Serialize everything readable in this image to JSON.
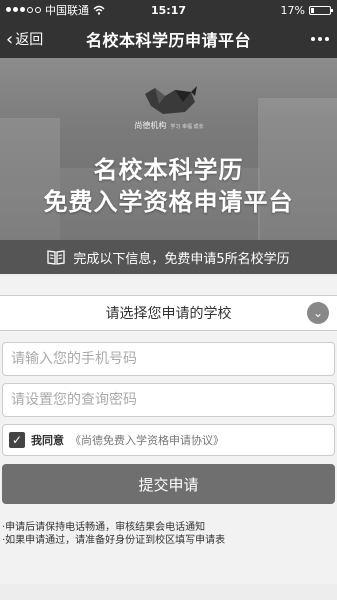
{
  "status_bar": {
    "carrier": "中国联通",
    "time": "15:17",
    "battery": "17%",
    "battery_level": 0.17
  },
  "nav": {
    "back_label": "返回",
    "title": "名校本科学历申请平台"
  },
  "banner": {
    "logo_text": "尚德机构",
    "logo_sub": "学习 幸福 成长",
    "title_line1": "名校本科学历",
    "title_line2": "免费入学资格申请平台"
  },
  "info_strip": {
    "text": "完成以下信息，免费申请5所名校学历"
  },
  "form": {
    "school_select_label": "请选择您申请的学校",
    "phone_placeholder": "请输入您的手机号码",
    "password_placeholder": "请设置您的查询密码",
    "agree_label": "我同意",
    "agree_link": "《尚德免费入学资格申请协议》",
    "agree_checked": true,
    "submit_label": "提交申请"
  },
  "notes": [
    "·申请后请保持电话畅通，审核结果会电话通知",
    "·如果申请通过，请准备好身份证到校区填写申请表"
  ]
}
